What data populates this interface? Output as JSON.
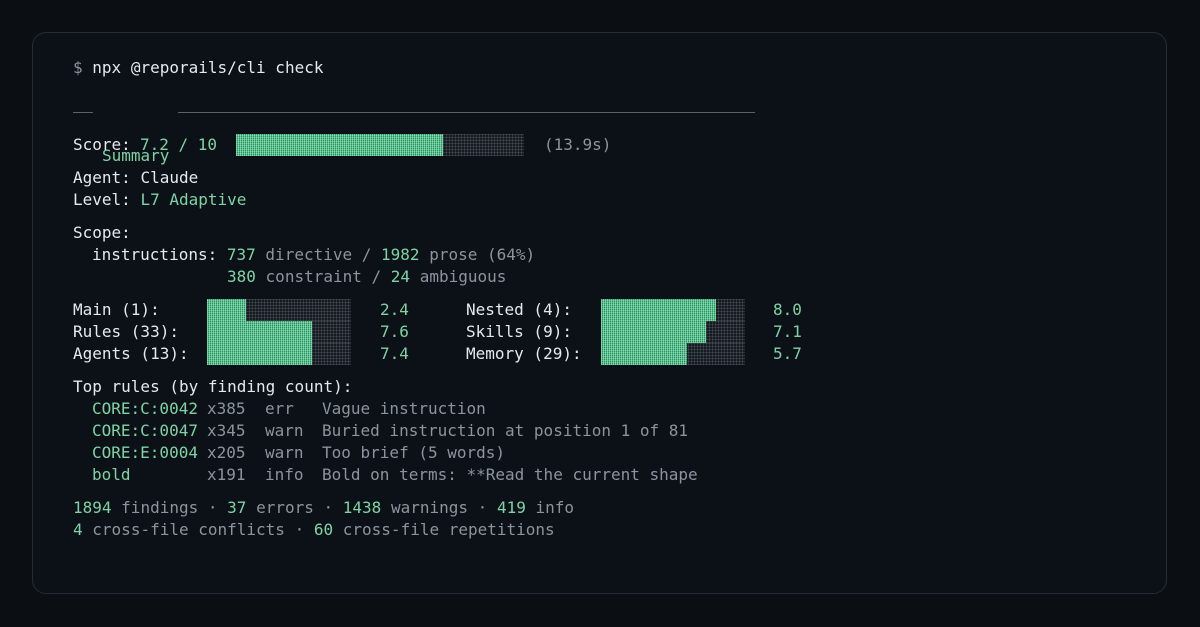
{
  "command": {
    "prompt": "$",
    "text": "npx @reporails/cli check"
  },
  "summary": {
    "heading": "Summary",
    "score_label": "Score:",
    "score_value": "7.2 / 10",
    "score_fraction": 0.72,
    "elapsed": "(13.9s)",
    "agent_label": "Agent:",
    "agent_value": "Claude",
    "level_label": "Level:",
    "level_value": "L7 Adaptive"
  },
  "scope": {
    "label": "Scope:",
    "instructions_label": "instructions:",
    "directive_count": "737",
    "directive_label": "directive /",
    "prose_count": "1982",
    "prose_label": "prose (64%)",
    "constraint_count": "380",
    "constraint_label": "constraint /",
    "ambiguous_count": "24",
    "ambiguous_label": "ambiguous"
  },
  "categories": {
    "left": [
      {
        "label": "Main (1):",
        "score": "2.4",
        "fraction": 0.27
      },
      {
        "label": "Rules (33):",
        "score": "7.6",
        "fraction": 0.73
      },
      {
        "label": "Agents (13):",
        "score": "7.4",
        "fraction": 0.73
      }
    ],
    "right": [
      {
        "label": "Nested (4):",
        "score": "8.0",
        "fraction": 0.8
      },
      {
        "label": "Skills (9):",
        "score": "7.1",
        "fraction": 0.73
      },
      {
        "label": "Memory (29):",
        "score": "5.7",
        "fraction": 0.6
      }
    ]
  },
  "top_rules": {
    "heading": "Top rules (by finding count):",
    "rows": [
      {
        "code": "CORE:C:0042",
        "count": "x385",
        "level": "err",
        "message": "Vague instruction"
      },
      {
        "code": "CORE:C:0047",
        "count": "x345",
        "level": "warn",
        "message": "Buried instruction at position 1 of 81"
      },
      {
        "code": "CORE:E:0004",
        "count": "x205",
        "level": "warn",
        "message": "Too brief (5 words)"
      },
      {
        "code": "bold",
        "count": "x191",
        "level": "info",
        "message": "Bold on terms: **Read the current shape"
      }
    ]
  },
  "totals": {
    "findings_count": "1894",
    "findings_label": "findings",
    "sep": "·",
    "errors_count": "37",
    "errors_label": "errors",
    "warnings_count": "1438",
    "warnings_label": "warnings",
    "info_count": "419",
    "info_label": "info",
    "conflicts_count": "4",
    "conflicts_label": "cross-file conflicts",
    "repetitions_count": "60",
    "repetitions_label": "cross-file repetitions"
  },
  "colors": {
    "accent": "#7ed3a4",
    "dim": "#8b949e",
    "text": "#e6e8eb",
    "background": "#0b0f14"
  }
}
